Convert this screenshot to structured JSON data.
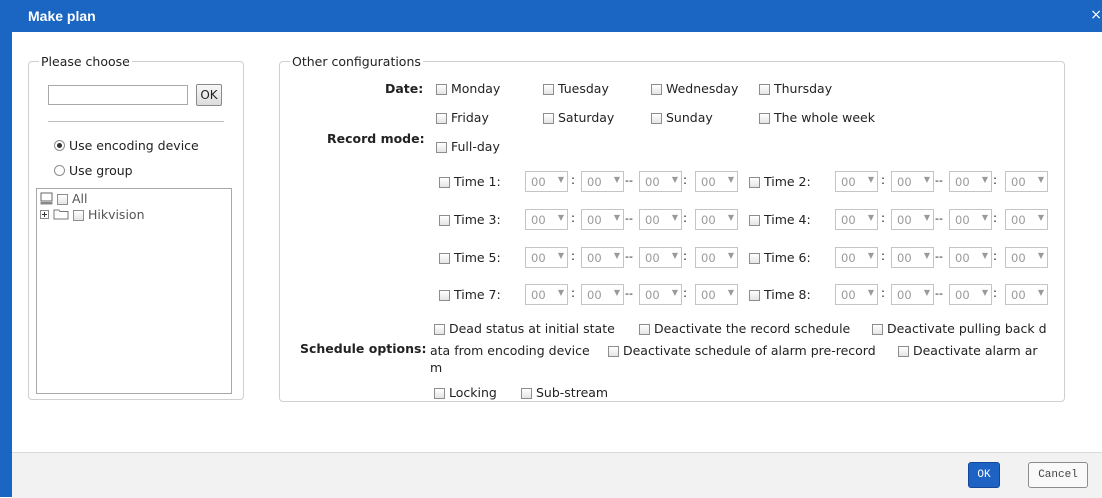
{
  "dialog": {
    "title": "Make plan",
    "close_glyph": "×"
  },
  "left_panel": {
    "legend": "Please choose",
    "search": {
      "value": "",
      "placeholder": ""
    },
    "ok_label": "OK",
    "radios": [
      {
        "label": "Use encoding device",
        "checked": true
      },
      {
        "label": "Use group",
        "checked": false
      }
    ],
    "tree": [
      {
        "label": "All",
        "icon": "computer-icon"
      },
      {
        "label": "Hikvision",
        "icon": "folder-icon"
      }
    ]
  },
  "right_panel": {
    "legend": "Other configurations",
    "date_label": "Date:",
    "days": [
      "Monday",
      "Tuesday",
      "Wednesday",
      "Thursday",
      "Friday",
      "Saturday",
      "Sunday",
      "The whole week"
    ],
    "record_mode_label": "Record mode:",
    "full_day_label": "Full-day",
    "time_slots": [
      {
        "label": "Time 1:"
      },
      {
        "label": "Time 2:"
      },
      {
        "label": "Time 3:"
      },
      {
        "label": "Time 4:"
      },
      {
        "label": "Time 5:"
      },
      {
        "label": "Time 6:"
      },
      {
        "label": "Time 7:"
      },
      {
        "label": "Time 8:"
      }
    ],
    "time_value": "00",
    "colon": ":",
    "dash": "--",
    "schedule_options_label": "Schedule options:",
    "options": {
      "dead_status": "Dead status at initial state",
      "deactivate_record": "Deactivate the record schedule",
      "deactivate_pull_line1": "Deactivate pulling back d",
      "deactivate_pull_line2": "ata from encoding device",
      "deactivate_prerecord": "Deactivate schedule of alarm pre-record",
      "deactivate_alarm_line1": "Deactivate alarm ar",
      "deactivate_alarm_line2": "m",
      "locking": "Locking",
      "sub_stream": "Sub-stream"
    }
  },
  "footer": {
    "ok_label": "OK",
    "cancel_label": "Cancel"
  },
  "colors": {
    "title_bar": "#1a66c2",
    "ok_button": "#1e62c4"
  }
}
